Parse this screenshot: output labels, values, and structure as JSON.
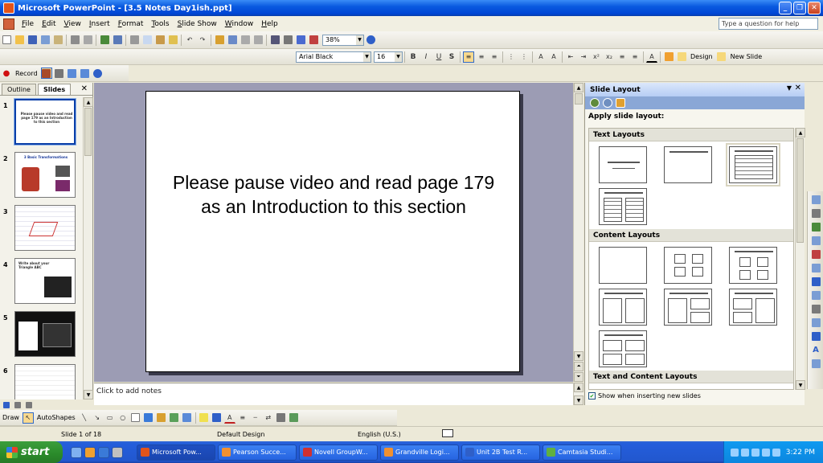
{
  "window": {
    "title": "Microsoft PowerPoint - [3.5 Notes Day1ish.ppt]",
    "btn_min": "_",
    "btn_max": "❐",
    "btn_close": "✕"
  },
  "menu": {
    "items": [
      "File",
      "Edit",
      "View",
      "Insert",
      "Format",
      "Tools",
      "Slide Show",
      "Window",
      "Help"
    ],
    "help_placeholder": "Type a question for help"
  },
  "toolbar_standard": {
    "zoom": "38%"
  },
  "toolbar_format": {
    "font": "Arial Black",
    "size": "16",
    "bold": "B",
    "italic": "I",
    "underline": "U",
    "shadow": "S",
    "design_label": "Design",
    "new_slide_label": "New Slide"
  },
  "toolbar_record": {
    "record_label": "Record"
  },
  "left_panel": {
    "tabs": [
      "Outline",
      "Slides"
    ],
    "close": "✕",
    "thumbnails": [
      {
        "num": "1",
        "caption": "Please pause video and read page 179 as an Introduction to this section"
      },
      {
        "num": "2",
        "caption": "3 Basic Transformations"
      },
      {
        "num": "3",
        "caption": ""
      },
      {
        "num": "4",
        "caption": "Write about your Triangle ABC"
      },
      {
        "num": "5",
        "caption": ""
      },
      {
        "num": "6",
        "caption": ""
      }
    ]
  },
  "slide": {
    "line1": "Please pause video and read page 179",
    "line2": "as an Introduction to this section"
  },
  "notes": {
    "placeholder": "Click to add notes"
  },
  "task_pane": {
    "title": "Slide Layout",
    "apply_label": "Apply slide layout:",
    "sections": [
      "Text Layouts",
      "Content Layouts",
      "Text and Content Layouts"
    ],
    "show_when_inserting": "Show when inserting new slides"
  },
  "draw_toolbar": {
    "draw_label": "Draw",
    "autoshapes_label": "AutoShapes"
  },
  "status": {
    "slide_of": "Slide 1 of 18",
    "design": "Default Design",
    "language": "English (U.S.)"
  },
  "taskbar": {
    "start_label": "start",
    "tasks": [
      "Microsoft Pow...",
      "Pearson Succe...",
      "Novell GroupW...",
      "Grandville Logi...",
      "Unit 2B Test R...",
      "Camtasia Studi..."
    ],
    "clock": "3:22 PM"
  },
  "colors": {
    "titlebar": "#0a5ae0",
    "canvas_bg": "#9c9cb4",
    "taskbar": "#245edb",
    "start_green": "#3c9f3c"
  }
}
